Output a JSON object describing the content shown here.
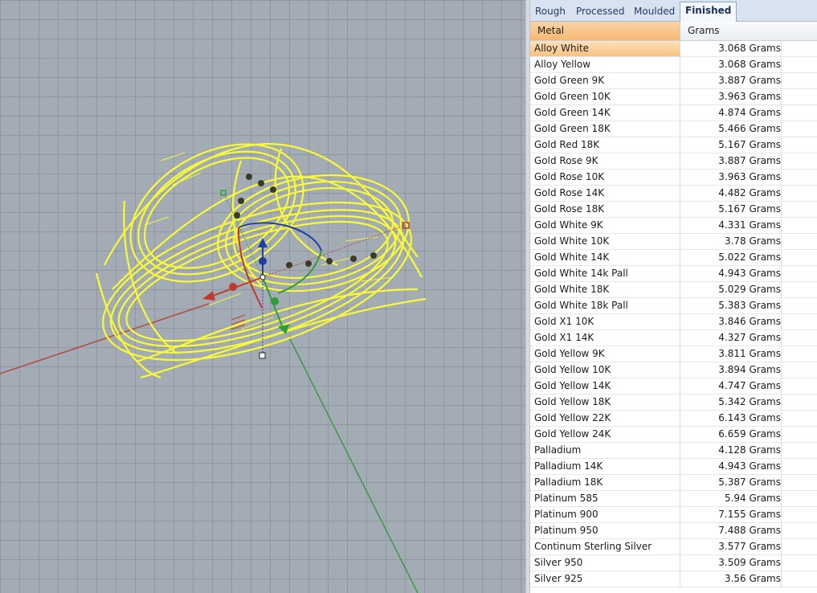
{
  "viewport": {
    "object_color": "#ffff2e",
    "x_axis_color": "#c0392b",
    "y_axis_color": "#2e9e3a",
    "gumball_icons": [
      "move-arrow-z-icon",
      "move-arrow-x-icon",
      "move-arrow-y-icon",
      "rotate-arc-icon",
      "scale-handle-icon"
    ]
  },
  "tabs": [
    {
      "label": "Rough",
      "active": false
    },
    {
      "label": "Processed",
      "active": false
    },
    {
      "label": "Moulded",
      "active": false
    },
    {
      "label": "Finished",
      "active": true
    }
  ],
  "table": {
    "headers": {
      "metal": "Metal",
      "grams": "Grams"
    },
    "selected_index": 0,
    "rows": [
      {
        "metal": "Alloy White",
        "grams": "3.068 Grams"
      },
      {
        "metal": "Alloy Yellow",
        "grams": "3.068 Grams"
      },
      {
        "metal": "Gold Green 9K",
        "grams": "3.887 Grams"
      },
      {
        "metal": "Gold Green 10K",
        "grams": "3.963 Grams"
      },
      {
        "metal": "Gold Green 14K",
        "grams": "4.874 Grams"
      },
      {
        "metal": "Gold Green 18K",
        "grams": "5.466 Grams"
      },
      {
        "metal": "Gold Red 18K",
        "grams": "5.167 Grams"
      },
      {
        "metal": "Gold Rose 9K",
        "grams": "3.887 Grams"
      },
      {
        "metal": "Gold Rose 10K",
        "grams": "3.963 Grams"
      },
      {
        "metal": "Gold Rose 14K",
        "grams": "4.482 Grams"
      },
      {
        "metal": "Gold Rose 18K",
        "grams": "5.167 Grams"
      },
      {
        "metal": "Gold White 9K",
        "grams": "4.331 Grams"
      },
      {
        "metal": "Gold White 10K",
        "grams": "3.78 Grams"
      },
      {
        "metal": "Gold White 14K",
        "grams": "5.022 Grams"
      },
      {
        "metal": "Gold White 14k Pall",
        "grams": "4.943 Grams"
      },
      {
        "metal": "Gold White 18K",
        "grams": "5.029 Grams"
      },
      {
        "metal": "Gold White 18k Pall",
        "grams": "5.383 Grams"
      },
      {
        "metal": "Gold X1 10K",
        "grams": "3.846 Grams"
      },
      {
        "metal": "Gold X1 14K",
        "grams": "4.327 Grams"
      },
      {
        "metal": "Gold Yellow 9K",
        "grams": "3.811 Grams"
      },
      {
        "metal": "Gold Yellow 10K",
        "grams": "3.894 Grams"
      },
      {
        "metal": "Gold Yellow 14K",
        "grams": "4.747 Grams"
      },
      {
        "metal": "Gold Yellow 18K",
        "grams": "5.342 Grams"
      },
      {
        "metal": "Gold Yellow 22K",
        "grams": "6.143 Grams"
      },
      {
        "metal": "Gold Yellow 24K",
        "grams": "6.659 Grams"
      },
      {
        "metal": "Palladium",
        "grams": "4.128 Grams"
      },
      {
        "metal": "Palladium 14K",
        "grams": "4.943 Grams"
      },
      {
        "metal": "Palladium 18K",
        "grams": "5.387 Grams"
      },
      {
        "metal": "Platinum 585",
        "grams": "5.94 Grams"
      },
      {
        "metal": "Platinum 900",
        "grams": "7.155 Grams"
      },
      {
        "metal": "Platinum 950",
        "grams": "7.488 Grams"
      },
      {
        "metal": "Continum Sterling Silver",
        "grams": "3.577 Grams"
      },
      {
        "metal": "Silver 950",
        "grams": "3.509 Grams"
      },
      {
        "metal": "Silver 925",
        "grams": "3.56 Grams"
      }
    ]
  }
}
